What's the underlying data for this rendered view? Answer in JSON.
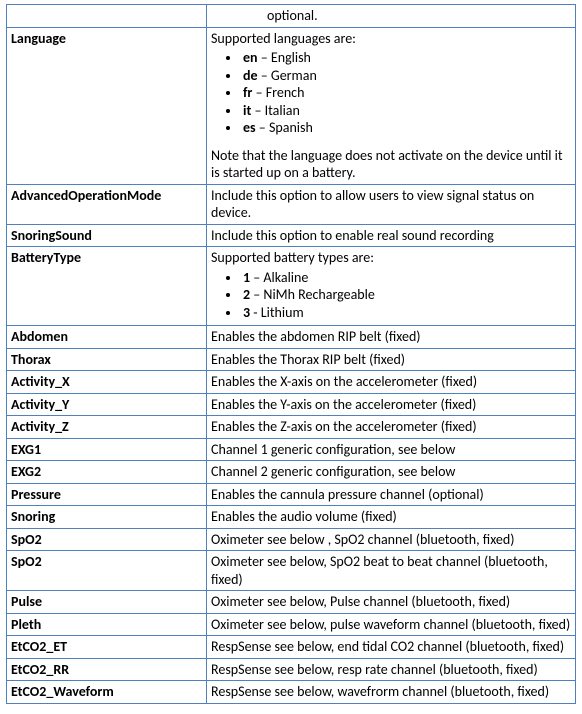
{
  "rows": [
    {
      "param": "",
      "desc_text": "optional."
    },
    {
      "param": "Language",
      "intro": "Supported languages are:",
      "items": [
        {
          "code": "en",
          "label": "English"
        },
        {
          "code": "de",
          "label": "German"
        },
        {
          "code": "fr",
          "label": "French"
        },
        {
          "code": "it",
          "label": "Italian"
        },
        {
          "code": "es",
          "label": "Spanish"
        }
      ],
      "note": "Note that the language does not activate on the device until it is started up on a battery."
    },
    {
      "param": "AdvancedOperationMode",
      "desc_text": "Include this option to allow users to view signal status on device."
    },
    {
      "param": "SnoringSound",
      "desc_text": "Include this option to enable real sound recording"
    },
    {
      "param": "BatteryType",
      "intro": "Supported battery types are:",
      "items": [
        {
          "code": "1",
          "label": "Alkaline"
        },
        {
          "code": "2",
          "label": "NiMh Rechargeable"
        },
        {
          "code": "3",
          "label": "Lithium",
          "sep": "-"
        }
      ]
    },
    {
      "param": "Abdomen",
      "desc_text": "Enables the abdomen RIP belt (fixed)"
    },
    {
      "param": "Thorax",
      "desc_text": "Enables the Thorax RIP belt (fixed)"
    },
    {
      "param": "Activity_X",
      "desc_text": "Enables the X-axis on the accelerometer (fixed)"
    },
    {
      "param": "Activity_Y",
      "desc_text": "Enables the Y-axis on the accelerometer (fixed)"
    },
    {
      "param": "Activity_Z",
      "desc_text": "Enables the Z-axis on the accelerometer (fixed)"
    },
    {
      "param": "EXG1",
      "desc_text": "Channel 1 generic configuration, see below"
    },
    {
      "param": "EXG2",
      "desc_text": "Channel 2 generic configuration, see below"
    },
    {
      "param": "Pressure",
      "desc_text": "Enables the cannula pressure channel (optional)"
    },
    {
      "param": "Snoring",
      "desc_text": "Enables the audio volume (fixed)"
    },
    {
      "param": "SpO2",
      "desc_text": "Oximeter see below , SpO2 channel (bluetooth, fixed)"
    },
    {
      "param": "SpO2",
      "desc_text": "Oximeter see below, SpO2 beat to beat channel (bluetooth, fixed)"
    },
    {
      "param": "Pulse",
      "desc_text": "Oximeter see below,  Pulse channel (bluetooth, fixed)"
    },
    {
      "param": "Pleth",
      "desc_text": "Oximeter see below, pulse waveform channel  (bluetooth, fixed)"
    },
    {
      "param": "EtCO2_ET",
      "desc_text": "RespSense see below, end tidal CO2 channel (bluetooth, fixed)"
    },
    {
      "param": "EtCO2_RR",
      "desc_text": "RespSense see below, resp rate channel (bluetooth, fixed)"
    },
    {
      "param": "EtCO2_Waveform",
      "desc_text": "RespSense see below, wavefrorm channel (bluetooth, fixed)"
    }
  ]
}
